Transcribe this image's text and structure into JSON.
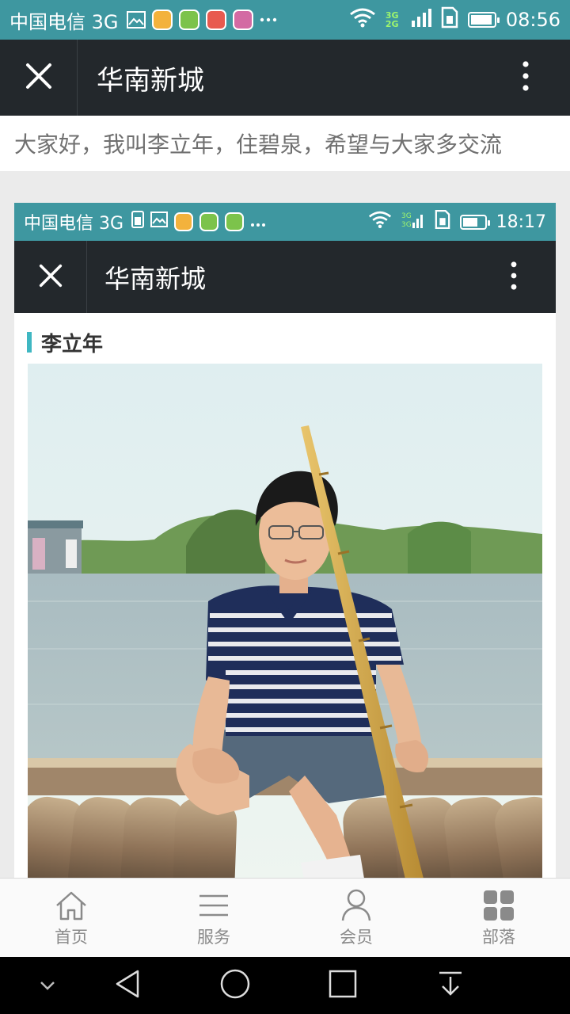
{
  "status_bar": {
    "carrier": "中国电信 3G",
    "network_badge": "3G 2G",
    "time": "08:56",
    "battery_percent": 80,
    "icons": [
      "image-icon",
      "app-icon",
      "app-icon",
      "weibo-icon",
      "game-icon",
      "more-dots-icon",
      "wifi-icon",
      "signal-icon",
      "sim-icon",
      "battery-icon"
    ]
  },
  "title_bar": {
    "title": "华南新城",
    "close_icon": "close-icon",
    "menu_icon": "more-vertical-icon"
  },
  "intro": {
    "text": "大家好，我叫李立年，住碧泉，希望与大家多交流"
  },
  "embedded_screenshot": {
    "status_bar": {
      "carrier": "中国电信 3G",
      "time": "18:17",
      "battery_percent": 60
    },
    "title_bar": {
      "title": "华南新城"
    },
    "section_title": "李立年"
  },
  "bottom_nav": {
    "items": [
      {
        "label": "首页",
        "icon": "home-icon"
      },
      {
        "label": "服务",
        "icon": "list-icon"
      },
      {
        "label": "会员",
        "icon": "user-icon"
      },
      {
        "label": "部落",
        "icon": "grid-icon"
      }
    ]
  },
  "system_nav": {
    "icons": [
      "collapse-icon",
      "back-icon",
      "home-circle-icon",
      "recents-icon",
      "download-icon"
    ]
  },
  "colors": {
    "status_bar": "#3e97a0",
    "title_bar": "#23282c",
    "accent": "#3fb7c2"
  }
}
